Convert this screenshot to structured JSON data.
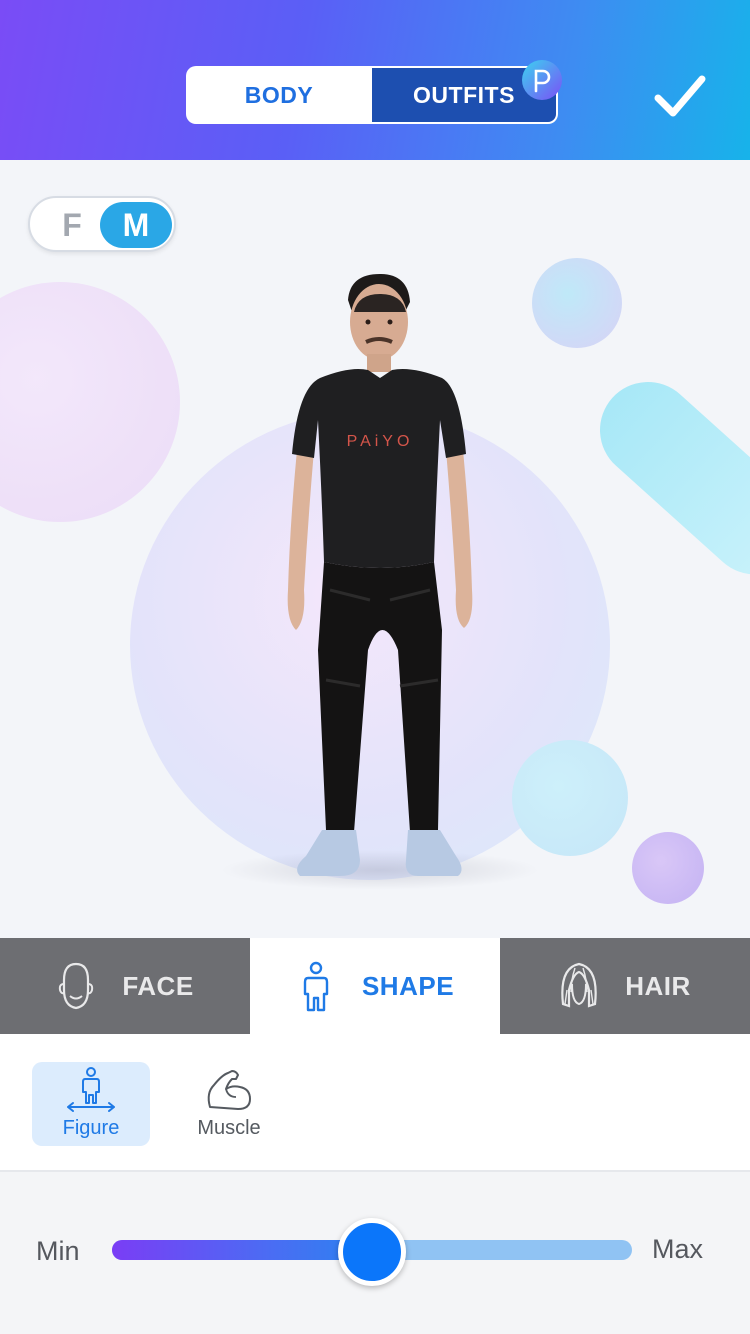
{
  "header": {
    "tabs": [
      {
        "label": "BODY",
        "active": true
      },
      {
        "label": "OUTFITS",
        "active": false
      }
    ],
    "badge_icon": "paiyo-p-icon",
    "confirm_icon": "checkmark-icon"
  },
  "gender_toggle": {
    "female_label": "F",
    "male_label": "M",
    "selected": "M"
  },
  "avatar": {
    "shirt_text": "PAiYO"
  },
  "category_tabs": [
    {
      "label": "FACE",
      "icon": "face-icon",
      "active": false
    },
    {
      "label": "SHAPE",
      "icon": "body-figure-icon",
      "active": true
    },
    {
      "label": "HAIR",
      "icon": "hair-icon",
      "active": false
    }
  ],
  "sub_options": [
    {
      "label": "Figure",
      "icon": "figure-width-icon",
      "selected": true
    },
    {
      "label": "Muscle",
      "icon": "flexed-bicep-icon",
      "selected": false
    }
  ],
  "slider": {
    "min_label": "Min",
    "max_label": "Max",
    "value": 0.5
  },
  "colors": {
    "accent": "#1f7ae6",
    "header_start": "#7a4cf6",
    "header_end": "#17b3ea",
    "tab_inactive": "#6d6e72",
    "toggle_active": "#2aa7e6"
  }
}
